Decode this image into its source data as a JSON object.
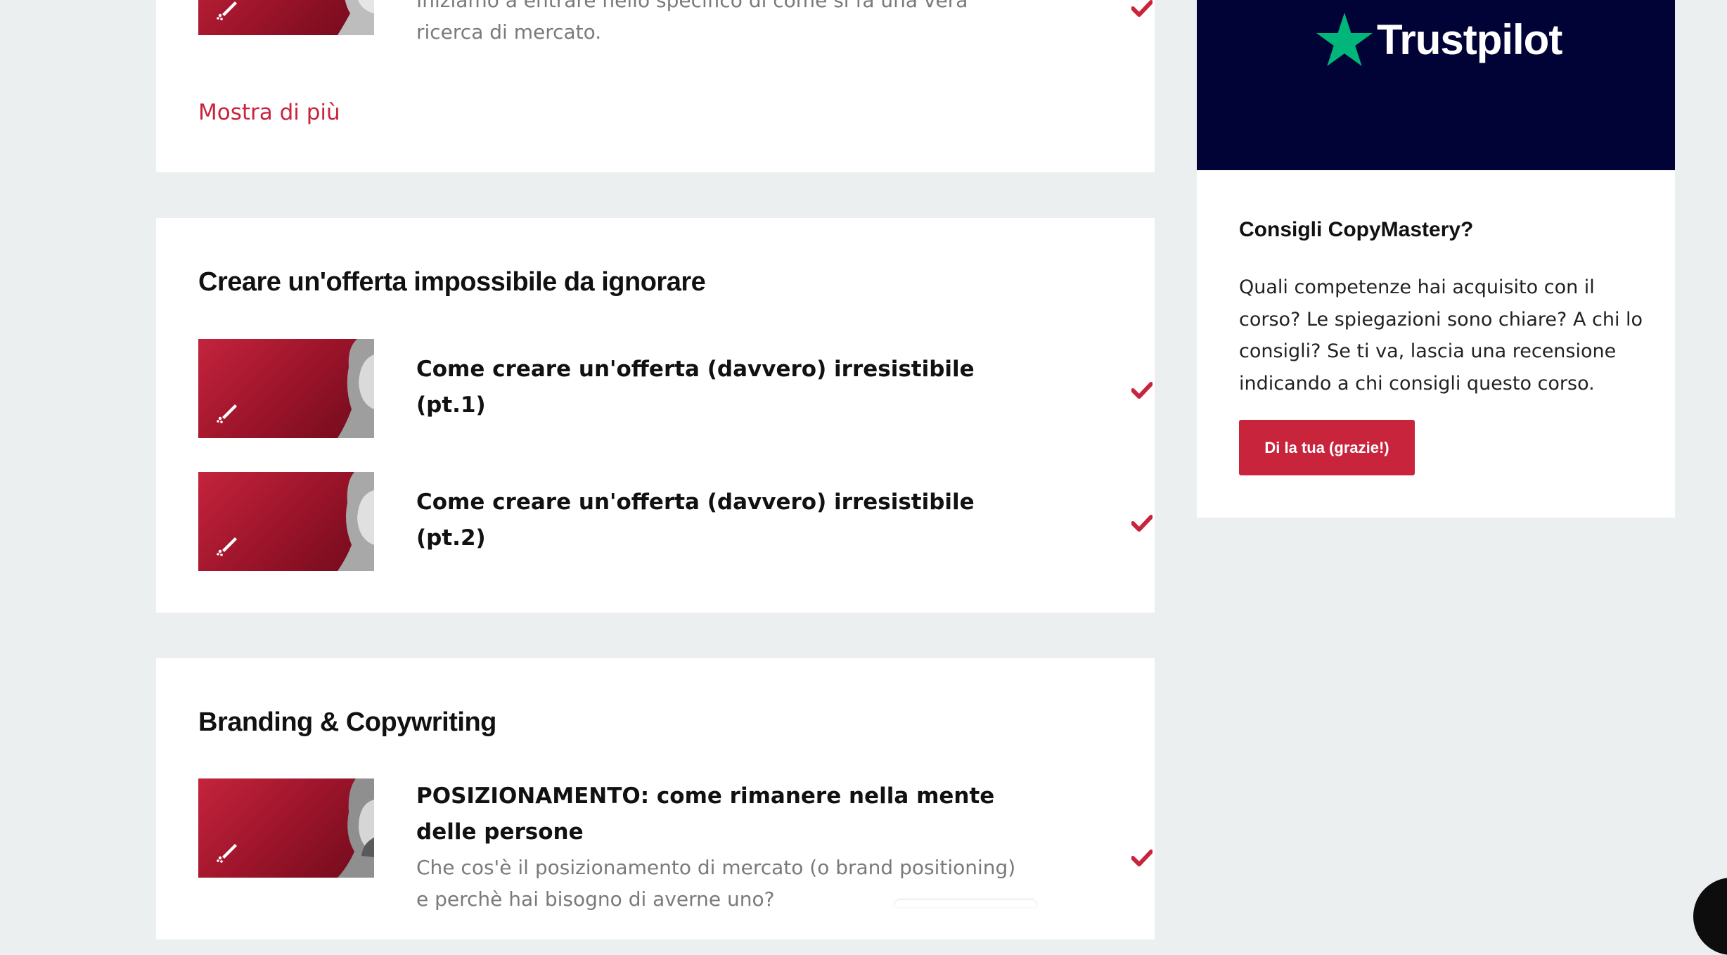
{
  "sections": [
    {
      "lessons": [
        {
          "description": "Iniziamo a entrare nello specifico di come si fa una vera ricerca di mercato."
        }
      ],
      "show_more_label": "Mostra di più"
    },
    {
      "title": "Creare un'offerta impossibile da ignorare",
      "lessons": [
        {
          "title": "Come creare un'offerta (davvero) irresistibile (pt.1)"
        },
        {
          "title": "Come creare un'offerta (davvero) irresistibile (pt.2)"
        }
      ]
    },
    {
      "title": "Branding & Copywriting",
      "lessons": [
        {
          "title": "POSIZIONAMENTO: come rimanere nella mente delle persone",
          "description": "Che cos'è il posizionamento di mercato (o brand positioning) e perchè hai bisogno di averne uno?"
        }
      ]
    }
  ],
  "sidebar": {
    "trustpilot": {
      "brand": "Trustpilot",
      "icon": "star-icon",
      "star_color": "#00b67a",
      "background": "#010337"
    },
    "review": {
      "heading": "Consigli CopyMastery?",
      "text": "Quali competenze hai acquisito con il corso? Le spiegazioni sono chiare? A chi lo consigli? Se ti va, lascia una recensione indicando a chi consigli questo corso.",
      "button_label": "Di la tua (grazie!)"
    }
  },
  "icons": {
    "completed": "check-icon",
    "thumbnail_badge": "quill-icon"
  },
  "colors": {
    "accent": "#c8253d",
    "page_background": "#ecefef",
    "card_background": "#ffffff"
  }
}
